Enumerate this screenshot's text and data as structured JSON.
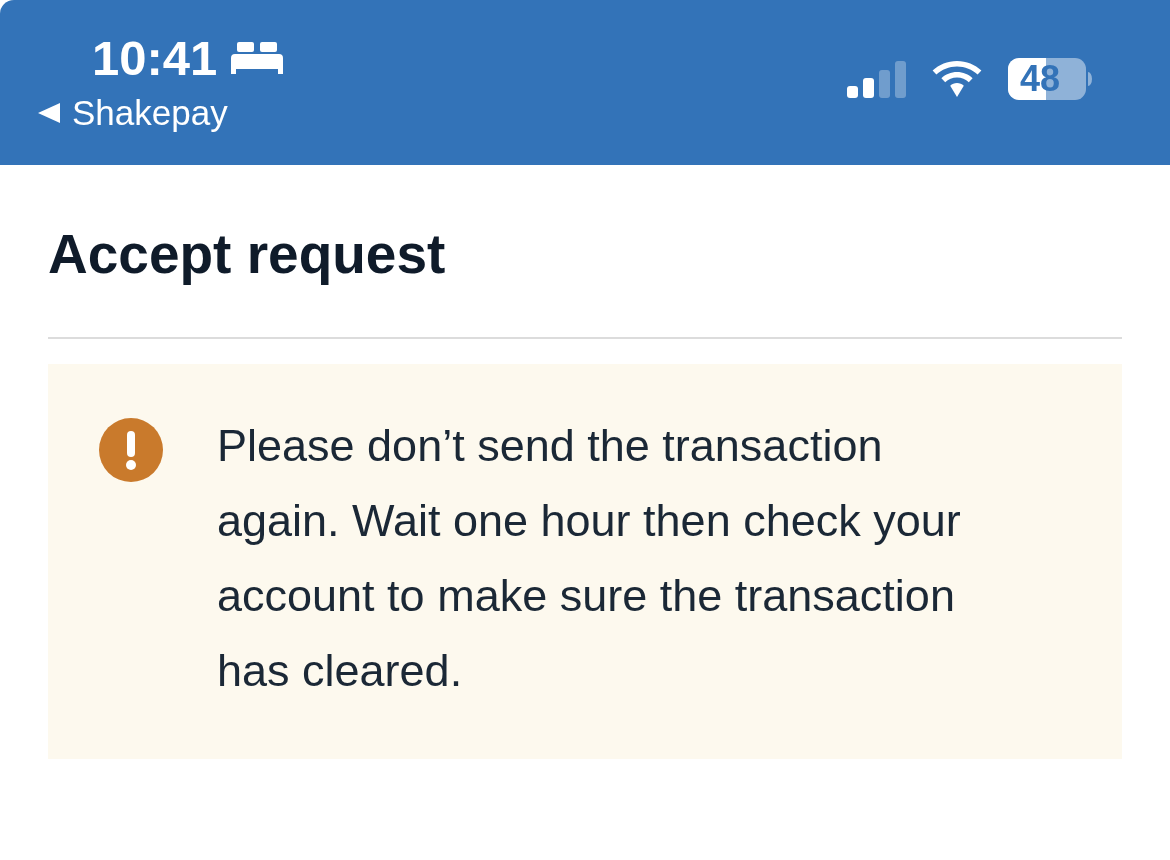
{
  "status_bar": {
    "time": "10:41",
    "back_label": "Shakepay",
    "battery": "48"
  },
  "header": {
    "title": "Accept request"
  },
  "notice": {
    "message": "Please don’t send the transaction again. Wait one hour then check your account to make sure the transaction has cleared."
  }
}
